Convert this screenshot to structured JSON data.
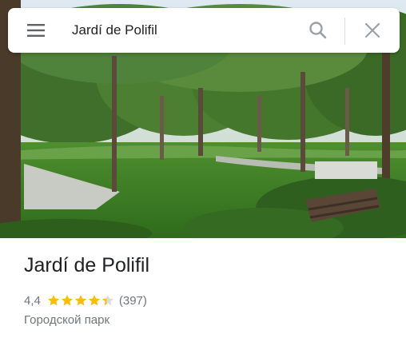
{
  "search": {
    "value": "Jardí de Polifil",
    "menu_icon": "hamburger-menu-icon",
    "search_icon": "magnifier-icon",
    "close_icon": "close-x-icon"
  },
  "place": {
    "name": "Jardí de Polifil",
    "rating": "4,4",
    "rating_value": 4.4,
    "stars_max": 5,
    "reviews": "(397)",
    "category": "Городской парк"
  },
  "colors": {
    "star": "#fbbc04",
    "star_empty": "#dadce0",
    "icon": "#70757a"
  }
}
